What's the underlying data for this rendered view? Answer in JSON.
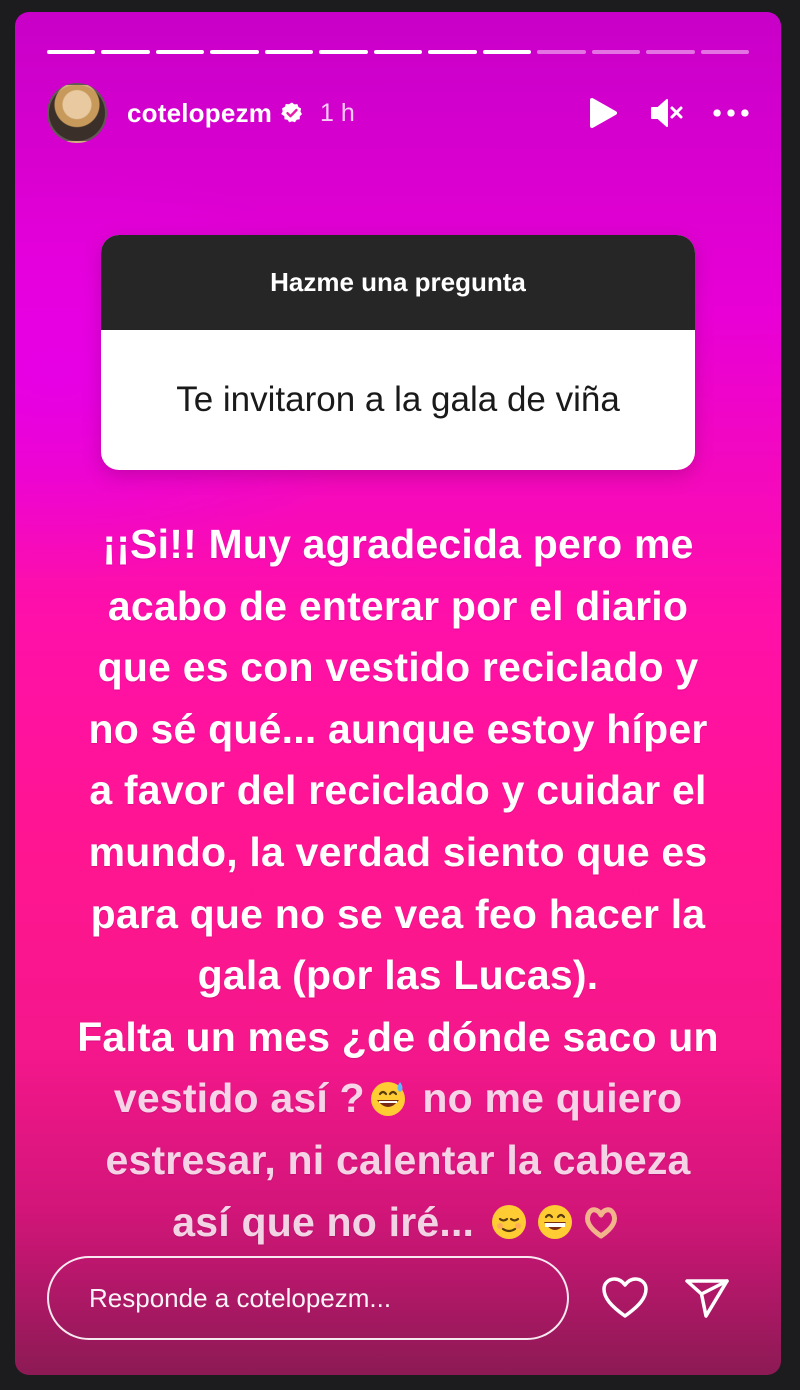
{
  "story": {
    "segments_total": 13,
    "segments_done": 9,
    "user": {
      "username": "cotelopezm",
      "verified": true,
      "time": "1 h"
    },
    "header_icons": [
      "play-icon",
      "mute-icon",
      "more-icon"
    ]
  },
  "question_sticker": {
    "title": "Hazme una pregunta",
    "question": "Te invitaron a la gala de viña"
  },
  "answer_lines": [
    "¡¡Si!! Muy agradecida pero me",
    "acabo de enterar por el diario",
    "que es con vestido reciclado y",
    "no sé qué... aunque estoy híper",
    "a favor del reciclado y cuidar el",
    "mundo, la verdad siento que es",
    "para que no se vea feo hacer la",
    "gala (por las Lucas).",
    "Falta un mes ¿de dónde saco un"
  ],
  "answer_line10": {
    "text": "vestido así ?",
    "text2": " no me quiero"
  },
  "answer_line11": "estresar, ni calentar la cabeza",
  "answer_line12": "así que no iré... ",
  "emojis": [
    "grinning-sweat-emoji",
    "relieved-emoji",
    "beaming-emoji",
    "heart-hands-emoji"
  ],
  "reply": {
    "placeholder": "Responde a cotelopezm..."
  },
  "footer_icons": [
    "heart-icon",
    "send-icon"
  ],
  "colors": {
    "verified": "#ffffff",
    "sticker_header": "#262626",
    "gradient_top": "#c800c8",
    "gradient_mid": "#ff1590"
  }
}
